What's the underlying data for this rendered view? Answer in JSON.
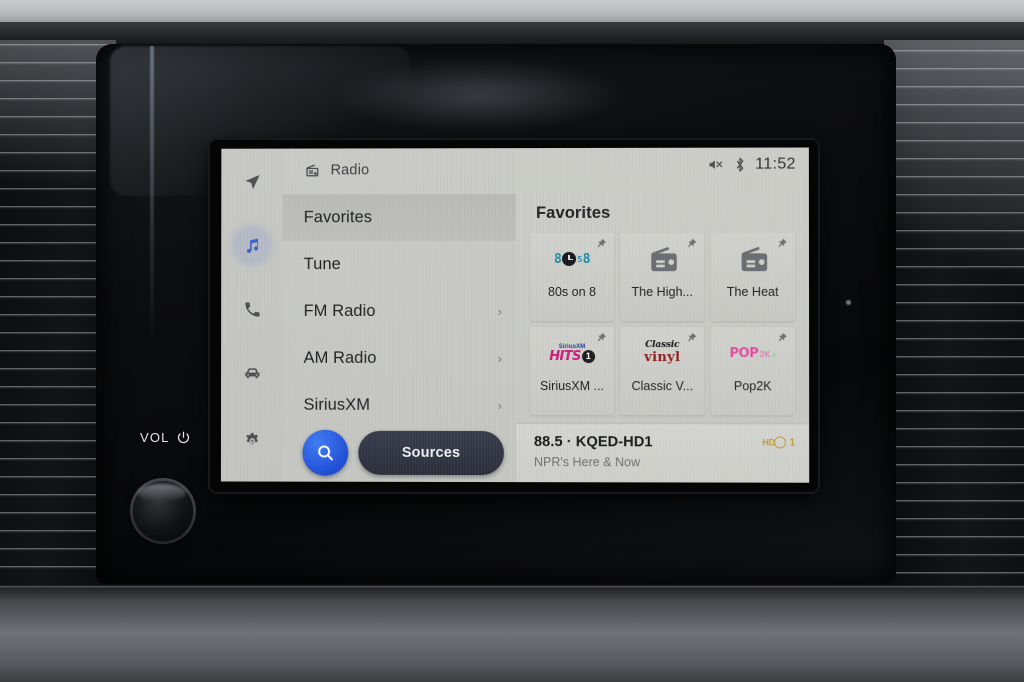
{
  "device": {
    "volume_label": "VOL",
    "power_icon": "power-icon",
    "knob": "volume-knob"
  },
  "screen": {
    "status_bar": {
      "mute_icon": "audio-mute-icon",
      "bluetooth_icon": "bluetooth-icon",
      "time": "11:52"
    },
    "source_header": {
      "icon": "radio-icon",
      "label": "Radio"
    },
    "rail": [
      {
        "name": "navigation",
        "icon": "navigation-arrow-icon",
        "active": false
      },
      {
        "name": "media",
        "icon": "music-note-icon",
        "active": true
      },
      {
        "name": "phone",
        "icon": "phone-icon",
        "active": false
      },
      {
        "name": "vehicle",
        "icon": "car-icon",
        "active": false
      },
      {
        "name": "settings",
        "icon": "gear-icon",
        "active": false
      }
    ],
    "menu": [
      {
        "label": "Favorites",
        "selected": true,
        "chevron": ""
      },
      {
        "label": "Tune",
        "selected": false,
        "chevron": ""
      },
      {
        "label": "FM Radio",
        "selected": false,
        "chevron": "›"
      },
      {
        "label": "AM Radio",
        "selected": false,
        "chevron": "›"
      },
      {
        "label": "SiriusXM",
        "selected": false,
        "chevron": "›"
      }
    ],
    "actions": {
      "search_icon": "search-icon",
      "sources_label": "Sources"
    },
    "panel": {
      "title": "Favorites",
      "tiles": [
        {
          "label": "80s on 8",
          "art": "logo-80s-on-8",
          "pin": "pin-icon"
        },
        {
          "label": "The High...",
          "art": "radio-glyph",
          "pin": "pin-icon"
        },
        {
          "label": "The Heat",
          "art": "radio-glyph",
          "pin": "pin-icon"
        },
        {
          "label": "SiriusXM ...",
          "art": "logo-siriusxm-hits",
          "pin": "pin-icon"
        },
        {
          "label": "Classic V...",
          "art": "logo-classic-vinyl",
          "pin": "pin-icon"
        },
        {
          "label": "Pop2K",
          "art": "logo-pop2k",
          "pin": "pin-icon"
        }
      ]
    },
    "now_playing": {
      "title": "88.5 · KQED-HD1",
      "subtitle": "NPR's Here & Now",
      "hd_label": "HD",
      "hd_channel": "1"
    }
  },
  "colors": {
    "accent_blue": "#2b55c8",
    "search_blue": "#1f4fd8",
    "sources_dark": "#2f3240",
    "screen_bg": "#cfd0cc",
    "hd_gold": "#c99a3a"
  }
}
